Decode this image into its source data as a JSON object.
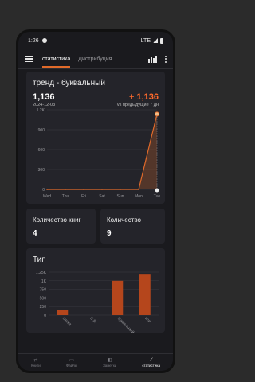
{
  "status": {
    "time": "1:26",
    "network": "LTE"
  },
  "tabs": [
    {
      "label": "статистика",
      "active": true
    },
    {
      "label": "Дистрибуция",
      "active": false
    }
  ],
  "trend": {
    "title": "тренд - буквальный",
    "total": "1,136",
    "date": "2024-12-03",
    "delta": "+ 1,136",
    "delta_sub": "vs предыдущие 7 дн"
  },
  "stats": {
    "books_label": "Количество книг",
    "books_value": "4",
    "count_label": "Количество",
    "count_value": "9"
  },
  "type_chart_title": "Тип",
  "chart_data": [
    {
      "type": "line",
      "title": "тренд - буквальный",
      "categories": [
        "Wed",
        "Thu",
        "Fri",
        "Sat",
        "Sun",
        "Mon",
        "Tue"
      ],
      "series": [
        {
          "values": [
            0,
            0,
            0,
            0,
            0,
            0,
            1136
          ]
        }
      ],
      "yticks": [
        "0",
        "300",
        "600",
        "900",
        "1.2K"
      ],
      "ylim": [
        0,
        1200
      ],
      "grid": true,
      "color": "#e06a2a"
    },
    {
      "type": "bar",
      "title": "Тип",
      "categories": [
        "слова",
        "C.P.",
        "буквальный",
        "все"
      ],
      "values": [
        140,
        0,
        1000,
        1200
      ],
      "yticks": [
        "0",
        "250",
        "500",
        "750",
        "1K",
        "1.25K"
      ],
      "ylim": [
        0,
        1250
      ],
      "grid": true,
      "color": "#b5461c"
    }
  ],
  "bottomnav": [
    {
      "label": "Книги",
      "icon": "book-icon",
      "active": false
    },
    {
      "label": "Файлы",
      "icon": "folder-icon",
      "active": false
    },
    {
      "label": "Заметки",
      "icon": "notes-icon",
      "active": false
    },
    {
      "label": "статистика",
      "icon": "stats-icon",
      "active": true
    }
  ]
}
